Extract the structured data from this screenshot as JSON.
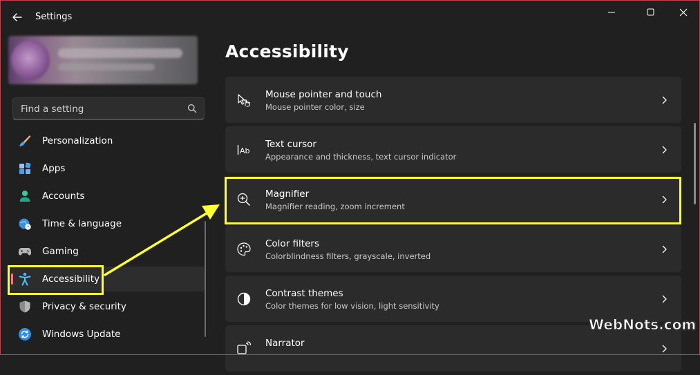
{
  "window": {
    "title": "Settings"
  },
  "search": {
    "placeholder": "Find a setting"
  },
  "sidebar": {
    "items": [
      {
        "label": "Personalization",
        "icon": "paintbrush-icon"
      },
      {
        "label": "Apps",
        "icon": "apps-icon"
      },
      {
        "label": "Accounts",
        "icon": "person-icon"
      },
      {
        "label": "Time & language",
        "icon": "globe-clock-icon"
      },
      {
        "label": "Gaming",
        "icon": "gamepad-icon"
      },
      {
        "label": "Accessibility",
        "icon": "accessibility-icon",
        "selected": true
      },
      {
        "label": "Privacy & security",
        "icon": "shield-icon"
      },
      {
        "label": "Windows Update",
        "icon": "sync-icon"
      }
    ]
  },
  "main": {
    "title": "Accessibility",
    "cards": [
      {
        "title": "Mouse pointer and touch",
        "subtitle": "Mouse pointer color, size",
        "icon": "mouse-pointer-touch-icon"
      },
      {
        "title": "Text cursor",
        "subtitle": "Appearance and thickness, text cursor indicator",
        "icon": "text-cursor-icon"
      },
      {
        "title": "Magnifier",
        "subtitle": "Magnifier reading, zoom increment",
        "icon": "magnifier-icon"
      },
      {
        "title": "Color filters",
        "subtitle": "Colorblindness filters, grayscale, inverted",
        "icon": "palette-icon"
      },
      {
        "title": "Contrast themes",
        "subtitle": "Color themes for low vision, light sensitivity",
        "icon": "contrast-icon"
      },
      {
        "title": "Narrator",
        "subtitle": "",
        "icon": "narrator-icon"
      }
    ]
  },
  "watermark": {
    "text": "WebNots.com"
  },
  "colors": {
    "background": "#202020",
    "card": "#2b2b2b",
    "highlight": "#ffff33",
    "accent_blue": "#4cc2ff",
    "selection_pill": "#ff7a7a"
  }
}
